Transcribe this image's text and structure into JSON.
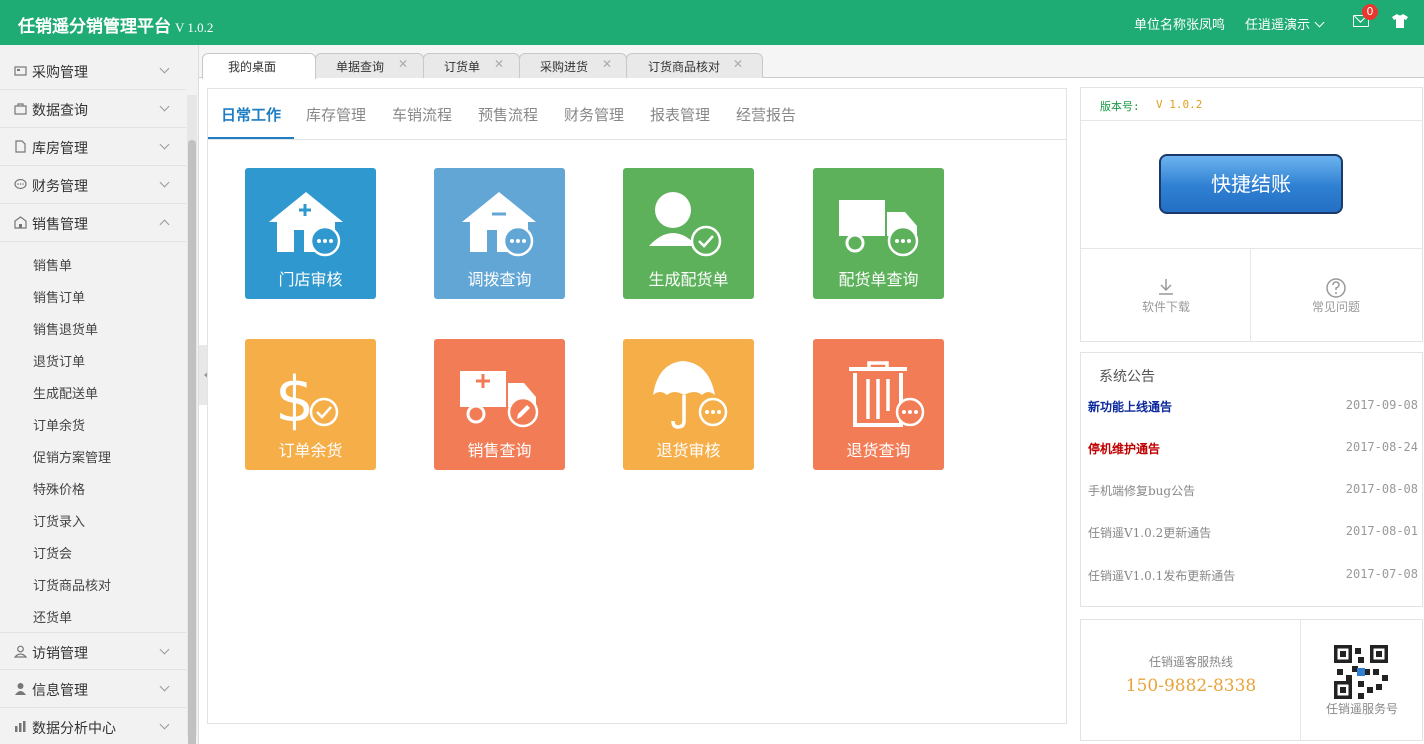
{
  "header": {
    "title": "任销遥分销管理平台",
    "version": "V 1.0.2",
    "org_label": "单位名称张凤鸣",
    "user": "任逍遥演示",
    "mail_count": "0"
  },
  "sidebar": {
    "groups": [
      {
        "label": "采购管理",
        "icon": "cart-icon"
      },
      {
        "label": "数据查询",
        "icon": "bag-icon"
      },
      {
        "label": "库房管理",
        "icon": "document-icon"
      },
      {
        "label": "财务管理",
        "icon": "chat-icon"
      },
      {
        "label": "销售管理",
        "icon": "store-icon",
        "expanded": true
      },
      {
        "label": "访销管理",
        "icon": "person-icon"
      },
      {
        "label": "信息管理",
        "icon": "user-icon"
      },
      {
        "label": "数据分析中心",
        "icon": "chart-icon"
      }
    ],
    "sales_items": [
      "销售单",
      "销售订单",
      "销售退货单",
      "退货订单",
      "生成配送单",
      "订单余货",
      "促销方案管理",
      "特殊价格",
      "订货录入",
      "订货会",
      "订货商品核对",
      "还货单"
    ]
  },
  "tabs": [
    {
      "label": "我的桌面",
      "closable": false
    },
    {
      "label": "单据查询",
      "closable": true
    },
    {
      "label": "订货单",
      "closable": true
    },
    {
      "label": "采购进货",
      "closable": true
    },
    {
      "label": "订货商品核对",
      "closable": true
    }
  ],
  "subtabs": [
    "日常工作",
    "库存管理",
    "车销流程",
    "预售流程",
    "财务管理",
    "报表管理",
    "经营报告"
  ],
  "tiles": [
    {
      "label": "门店审核",
      "color": "#2f98cf",
      "icon": "house-plus-icon"
    },
    {
      "label": "调拨查询",
      "color": "#62a6d6",
      "icon": "house-minus-icon"
    },
    {
      "label": "生成配货单",
      "color": "#5db15b",
      "icon": "person-check-icon"
    },
    {
      "label": "配货单查询",
      "color": "#5db15b",
      "icon": "truck-icon"
    },
    {
      "label": "订单余货",
      "color": "#f6ae48",
      "icon": "dollar-check-icon"
    },
    {
      "label": "销售查询",
      "color": "#f27c56",
      "icon": "truck-edit-icon"
    },
    {
      "label": "退货审核",
      "color": "#f6ae48",
      "icon": "umbrella-icon"
    },
    {
      "label": "退货查询",
      "color": "#f27c56",
      "icon": "trash-icon"
    }
  ],
  "right": {
    "version_label": "版本号:",
    "version_value": "V 1.0.2",
    "quick_button": "快捷结账",
    "download_label": "软件下载",
    "faq_label": "常见问题",
    "notice_title": "系统公告",
    "notices": [
      {
        "title": "新功能上线通告",
        "date": "2017-09-08",
        "color": "#0c2a9e",
        "bold": true
      },
      {
        "title": "停机维护通告",
        "date": "2017-08-24",
        "color": "#c00000",
        "bold": true
      },
      {
        "title": "手机端修复bug公告",
        "date": "2017-08-08",
        "color": "#888888",
        "bold": false
      },
      {
        "title": "任销遥V1.0.2更新通告",
        "date": "2017-08-01",
        "color": "#888888",
        "bold": false
      },
      {
        "title": "任销遥V1.0.1发布更新通告",
        "date": "2017-07-08",
        "color": "#888888",
        "bold": false
      }
    ],
    "hotline_label": "任销遥客服热线",
    "hotline_number": "150-9882-8338",
    "qr_label": "任销遥服务号"
  }
}
